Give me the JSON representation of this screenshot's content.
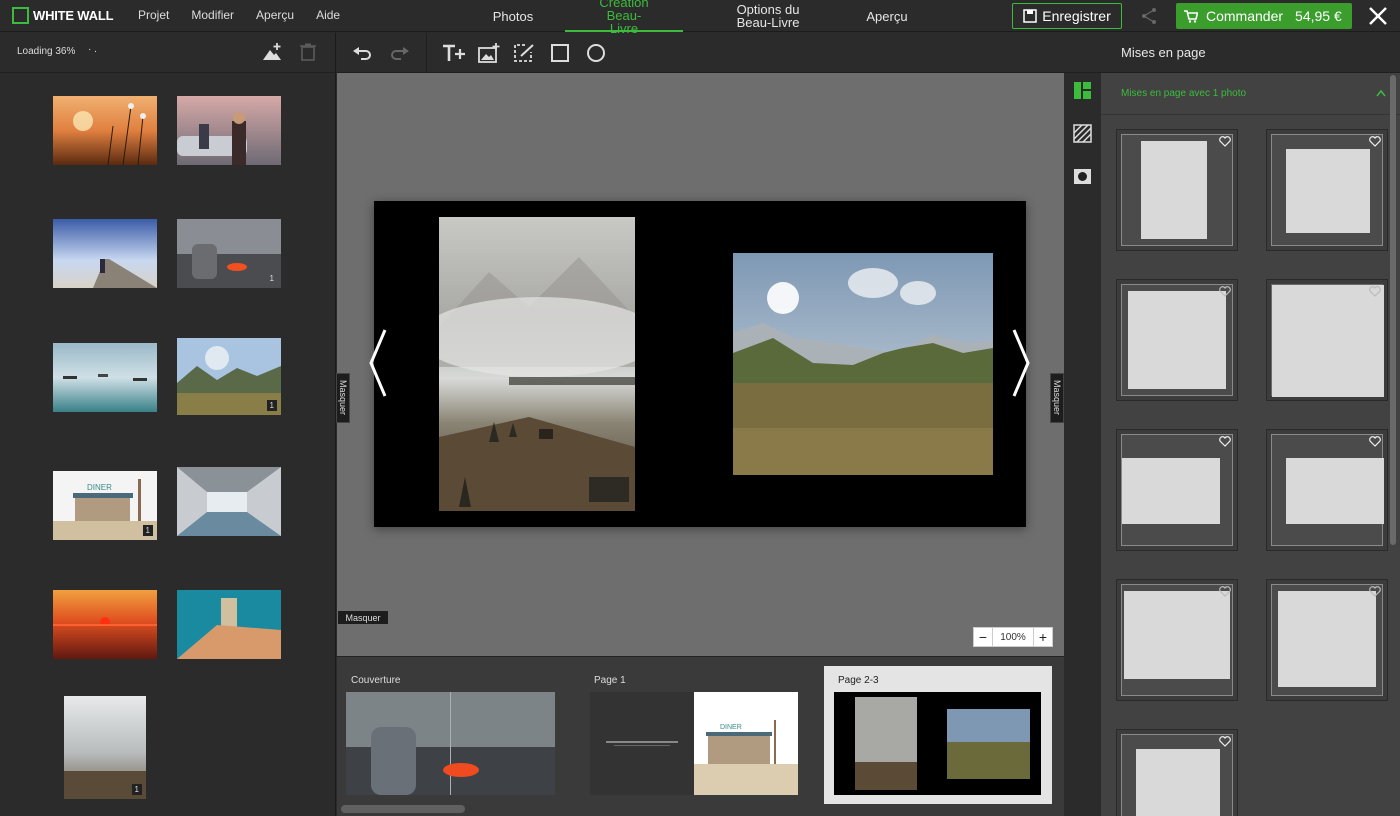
{
  "app": {
    "logo_text": "WHITE WALL",
    "accent_color": "#3dbb3d",
    "menu": [
      "Projet",
      "Modifier",
      "Aperçu",
      "Aide"
    ],
    "modes": [
      {
        "label": "Photos",
        "active": false
      },
      {
        "label": "Création Beau-Livre",
        "active": true
      },
      {
        "label": "Options du Beau-Livre",
        "active": false
      },
      {
        "label": "Aperçu",
        "active": false
      }
    ],
    "save_label": "Enregistrer",
    "order_label": "Commander",
    "order_price": "54,95 €"
  },
  "left_panel": {
    "loading_text": "Loading 36%",
    "photos": [
      {
        "name": "sunset-flowers",
        "badge": ""
      },
      {
        "name": "couple-car",
        "badge": ""
      },
      {
        "name": "pier-person",
        "badge": ""
      },
      {
        "name": "volcano-couple",
        "badge": "1"
      },
      {
        "name": "boats-lake",
        "badge": ""
      },
      {
        "name": "mountain-valley",
        "badge": "1"
      },
      {
        "name": "diner",
        "badge": "1"
      },
      {
        "name": "warehouse",
        "badge": ""
      },
      {
        "name": "red-sunset-sea",
        "badge": ""
      },
      {
        "name": "sand-room",
        "badge": ""
      },
      {
        "name": "misty-hills",
        "badge": "1"
      }
    ]
  },
  "editor": {
    "toolbar_icons": [
      "undo-icon",
      "redo-icon",
      "add-text-icon",
      "add-image-icon",
      "edit-frame-icon",
      "rectangle-icon",
      "circle-icon"
    ],
    "masquer_label": "Masquer",
    "zoom_value": "100%",
    "zoom_minus": "−",
    "zoom_plus": "+"
  },
  "pages": [
    {
      "label": "Couverture",
      "selected": false
    },
    {
      "label": "Page 1",
      "selected": false,
      "diner_sign": "DINER"
    },
    {
      "label": "Page 2-3",
      "selected": true
    }
  ],
  "right_panel": {
    "title": "Mises en page",
    "section_title": "Mises en page avec 1 photo",
    "strip_icons": [
      "layouts-icon",
      "background-pattern-icon",
      "masks-icon"
    ]
  }
}
